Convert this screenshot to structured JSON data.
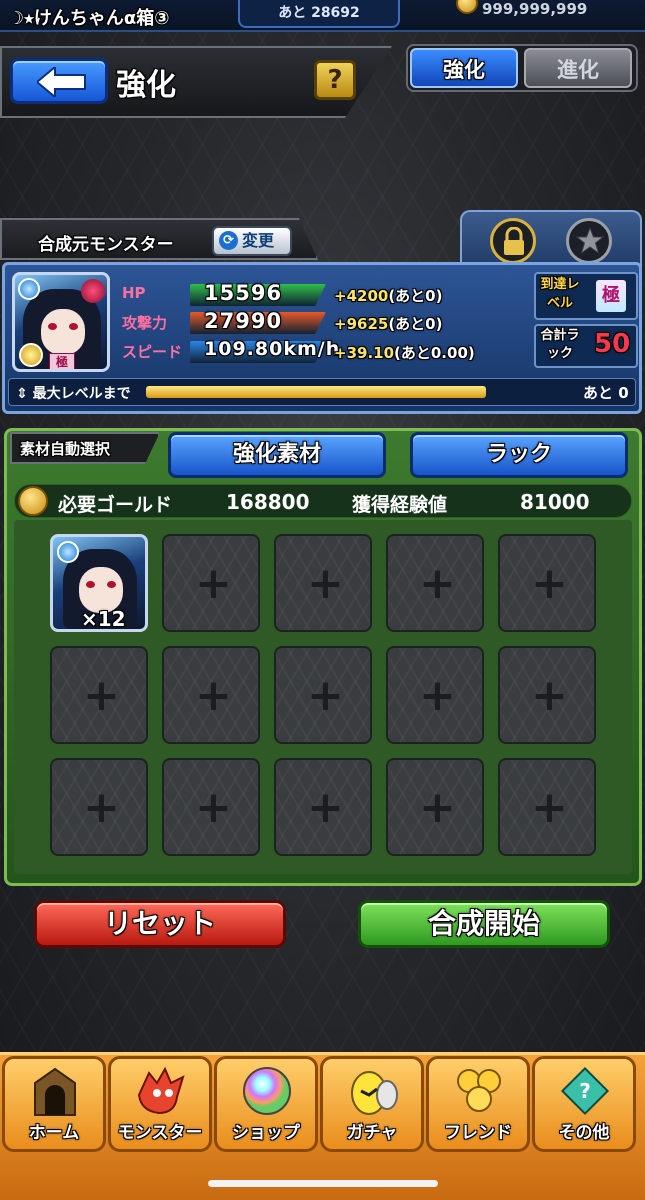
{
  "status": {
    "player_name": "☽⭑けんちゃんα箱③",
    "exp_remaining": "あと 28692",
    "gold_total": "999,999,999"
  },
  "header": {
    "title": "強化",
    "help_label": "?",
    "tabs": [
      {
        "label": "強化",
        "active": true
      },
      {
        "label": "進化",
        "active": false
      }
    ]
  },
  "base_monster": {
    "label": "合成元モンスター",
    "change_label": "変更",
    "portrait_badge": "極",
    "stats": [
      {
        "label": "HP",
        "value": "15596",
        "bonus_plus": "+4200",
        "bonus_rest": "(あと0)",
        "bar_color": "#2fbf4a"
      },
      {
        "label": "攻撃力",
        "value": "27990",
        "bonus_plus": "+9625",
        "bonus_rest": "(あと0)",
        "bar_color": "#e85a2a"
      },
      {
        "label": "スピード",
        "value": "109.80km/h",
        "bonus_plus": "+39.10",
        "bonus_rest": "(あと0.00)",
        "bar_color": "#2a86e8"
      }
    ],
    "reach_level_label": "到達レベル",
    "reach_level_value": "極",
    "luck_label": "合計ラック",
    "luck_value": "50",
    "max_level_label": "最大レベルまで",
    "max_level_remaining": "あと 0",
    "max_level_fill_fraction": 0.62
  },
  "material": {
    "auto_select_label": "素材自動選択",
    "material_button": "強化素材",
    "luck_button": "ラック",
    "gold_required_label": "必要ゴールド",
    "gold_required_value": "168800",
    "exp_gain_label": "獲得経験値",
    "exp_gain_value": "81000",
    "first_slot_count": "×12",
    "empty_slot_symbol": "+"
  },
  "actions": {
    "reset": "リセット",
    "start": "合成開始"
  },
  "nav": [
    {
      "label": "ホーム",
      "icon": "home-gate-icon"
    },
    {
      "label": "モンスター",
      "icon": "monster-dragon-icon"
    },
    {
      "label": "ショップ",
      "icon": "rainbow-orb-icon"
    },
    {
      "label": "ガチャ",
      "icon": "gacha-egg-icon"
    },
    {
      "label": "フレンド",
      "icon": "friend-balloons-icon"
    },
    {
      "label": "その他",
      "icon": "other-menu-icon"
    }
  ]
}
